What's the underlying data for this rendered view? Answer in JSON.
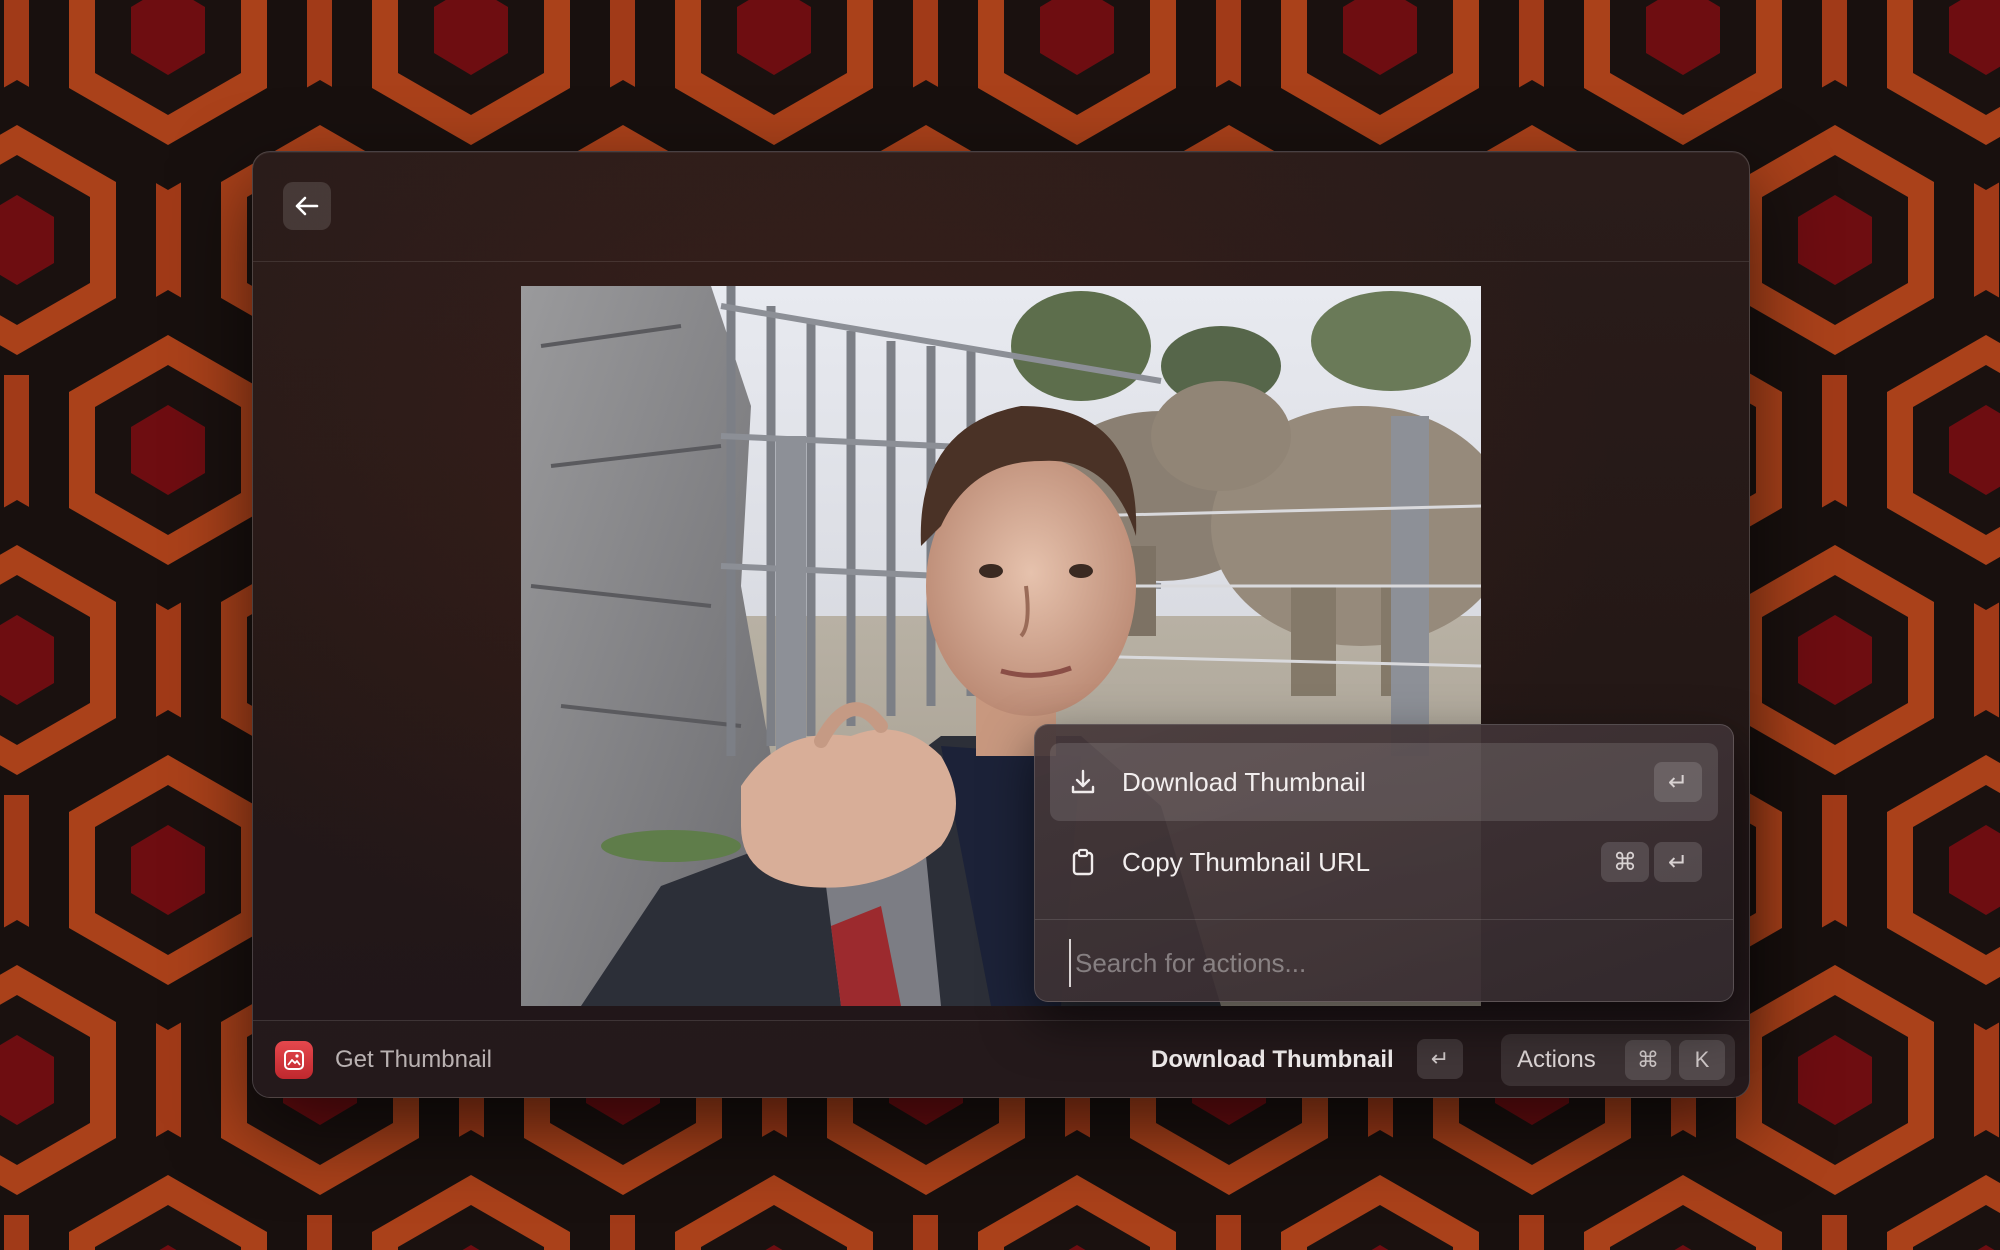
{
  "window": {
    "back_icon": "arrow-left-icon"
  },
  "thumbnail": {
    "description_icon": "video-thumbnail-image"
  },
  "action_panel": {
    "items": [
      {
        "label": "Download Thumbnail",
        "icon": "download-icon",
        "shortcut": [
          "↵"
        ],
        "selected": true
      },
      {
        "label": "Copy Thumbnail URL",
        "icon": "clipboard-icon",
        "shortcut": [
          "⌘",
          "↵"
        ],
        "selected": false
      }
    ],
    "search": {
      "placeholder": "Search for actions...",
      "value": ""
    }
  },
  "bottombar": {
    "app_icon": "image-download-icon",
    "app_name": "Get Thumbnail",
    "primary_action_label": "Download Thumbnail",
    "primary_action_key": "↵",
    "actions_label": "Actions",
    "actions_keys": [
      "⌘",
      "K"
    ]
  },
  "colors": {
    "accent_red": "#e5484d",
    "wallpaper_orange": "#c4481f",
    "wallpaper_dark": "#1e1412",
    "wallpaper_red": "#8a1014"
  }
}
